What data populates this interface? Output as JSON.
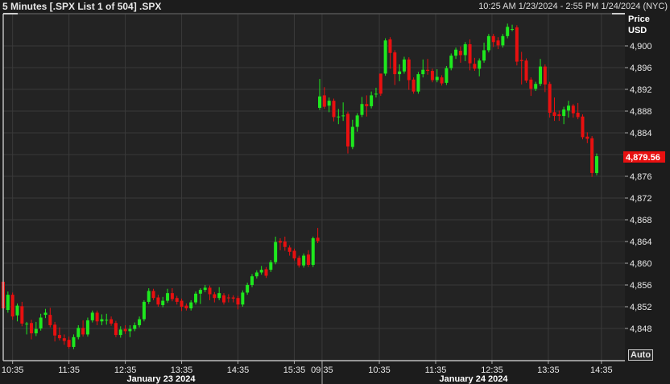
{
  "header": {
    "title": "5 Minutes [.SPX List 1 of 504] .SPX",
    "range": "10:25 AM 1/23/2024 - 2:55 PM 1/24/2024 (NYC)"
  },
  "axis_header": {
    "line1": "Price",
    "line2": "USD"
  },
  "auto_button": "Auto",
  "colors": {
    "up": "#1ee81e",
    "down": "#e81010",
    "bg": "#1c1c1c",
    "plot": "#232323",
    "grid": "#3a3a3a"
  },
  "chart_data": {
    "type": "candlestick",
    "title": "5 Minutes [.SPX List 1 of 504] .SPX",
    "ylabel": "Price USD",
    "ylim": [
      4844,
      4904
    ],
    "yticks": [
      "4,848",
      "4,852",
      "4,856",
      "4,860",
      "4,864",
      "4,868",
      "4,872",
      "4,876",
      "4,880",
      "4,884",
      "4,888",
      "4,892",
      "4,896",
      "4,900"
    ],
    "ytick_values": [
      4848,
      4852,
      4856,
      4860,
      4864,
      4868,
      4872,
      4876,
      4880,
      4884,
      4888,
      4892,
      4896,
      4900
    ],
    "last_price": {
      "value": 4879.56,
      "label": "4,879.56"
    },
    "xticks": [
      {
        "label": "10:35",
        "day": 0,
        "index": 2
      },
      {
        "label": "11:35",
        "day": 0,
        "index": 14
      },
      {
        "label": "12:35",
        "day": 0,
        "index": 26
      },
      {
        "label": "13:35",
        "day": 0,
        "index": 38
      },
      {
        "label": "14:35",
        "day": 0,
        "index": 50
      },
      {
        "label": "15:35",
        "day": 0,
        "index": 62
      },
      {
        "label": "09:35",
        "day": 1,
        "index": 0.5
      },
      {
        "label": "10:35",
        "day": 1,
        "index": 12.7
      },
      {
        "label": "11:35",
        "day": 1,
        "index": 24.7
      },
      {
        "label": "12:35",
        "day": 1,
        "index": 36.7
      },
      {
        "label": "13:35",
        "day": 1,
        "index": 48.7
      },
      {
        "label": "14:35",
        "day": 1,
        "index": 60
      }
    ],
    "days": [
      {
        "label": "January 23 2024",
        "candles": [
          [
            4856.6,
            4857.2,
            4850.9,
            4851.7
          ],
          [
            4851.4,
            4854.8,
            4850.9,
            4854.2
          ],
          [
            4854.2,
            4854.6,
            4849.6,
            4850.2
          ],
          [
            4850.4,
            4852.6,
            4849.3,
            4852.2
          ],
          [
            4852.1,
            4852.9,
            4848.4,
            4848.9
          ],
          [
            4848.9,
            4849.2,
            4846.9,
            4848.9
          ],
          [
            4849,
            4849.6,
            4846,
            4847.1
          ],
          [
            4847.1,
            4849.2,
            4846.6,
            4847.9
          ],
          [
            4848,
            4850.7,
            4847.6,
            4850
          ],
          [
            4850.5,
            4851.6,
            4849.9,
            4850.9
          ],
          [
            4850.5,
            4851.8,
            4848.2,
            4848.6
          ],
          [
            4848.7,
            4849.2,
            4845.6,
            4846.7
          ],
          [
            4846.8,
            4848.2,
            4845.8,
            4846.2
          ],
          [
            4846.2,
            4846.9,
            4845,
            4845.7
          ],
          [
            4845.9,
            4846.5,
            4844.3,
            4844.6
          ],
          [
            4844.6,
            4846.9,
            4844.2,
            4846.4
          ],
          [
            4846.4,
            4848.6,
            4846,
            4848.1
          ],
          [
            4848.1,
            4849.5,
            4846.5,
            4846.9
          ],
          [
            4846.9,
            4850,
            4846.5,
            4849.5
          ],
          [
            4849.5,
            4851.3,
            4849.1,
            4850.9
          ],
          [
            4850.9,
            4851.3,
            4848.6,
            4849.3
          ],
          [
            4849.3,
            4850.6,
            4848.6,
            4849.7
          ],
          [
            4849.6,
            4850.7,
            4848.7,
            4849.6
          ],
          [
            4849.7,
            4850.2,
            4848.5,
            4848.9
          ],
          [
            4849,
            4849.4,
            4846.4,
            4846.8
          ],
          [
            4846.8,
            4848.4,
            4846.3,
            4847.8
          ],
          [
            4847.9,
            4848.6,
            4847,
            4847.5
          ],
          [
            4847.5,
            4848.6,
            4846.4,
            4847.9
          ],
          [
            4847.9,
            4849.1,
            4847.5,
            4848.6
          ],
          [
            4848.6,
            4850.2,
            4848.2,
            4849.7
          ],
          [
            4849.7,
            4853.2,
            4849.3,
            4852.9
          ],
          [
            4852.9,
            4855.4,
            4852.5,
            4854.9
          ],
          [
            4854.9,
            4855.3,
            4853.2,
            4853.6
          ],
          [
            4853.7,
            4854.2,
            4852,
            4852.4
          ],
          [
            4852.3,
            4853.8,
            4851.9,
            4853.1
          ],
          [
            4853.1,
            4855.3,
            4852.7,
            4854.5
          ],
          [
            4854.5,
            4855.4,
            4853,
            4853.4
          ],
          [
            4853.6,
            4854,
            4852.4,
            4852.9
          ],
          [
            4853.1,
            4853.5,
            4851.2,
            4852
          ],
          [
            4852.2,
            4852.6,
            4851.3,
            4851.7
          ],
          [
            4851.7,
            4853.2,
            4851.3,
            4852.8
          ],
          [
            4852.8,
            4854.8,
            4852.4,
            4854.4
          ],
          [
            4854.4,
            4855.4,
            4852.5,
            4855.1
          ],
          [
            4855.1,
            4856,
            4854.7,
            4855.5
          ],
          [
            4855.5,
            4855.9,
            4853.2,
            4854.3
          ],
          [
            4854.3,
            4854.7,
            4852.8,
            4853.6
          ],
          [
            4853.6,
            4855.6,
            4853.2,
            4854.5
          ],
          [
            4854.1,
            4854.5,
            4852.4,
            4852.8
          ],
          [
            4853.7,
            4854.3,
            4852.8,
            4853.6
          ],
          [
            4853.7,
            4854.1,
            4852.8,
            4853.5
          ],
          [
            4853.6,
            4854,
            4851.5,
            4852.4
          ],
          [
            4852.4,
            4855,
            4852,
            4854.6
          ],
          [
            4854.6,
            4856.4,
            4854.2,
            4856
          ],
          [
            4856,
            4858,
            4855.6,
            4857.6
          ],
          [
            4857.6,
            4858.7,
            4857.2,
            4858.3
          ],
          [
            4858.3,
            4859.5,
            4857.9,
            4858.8
          ],
          [
            4858.9,
            4859.3,
            4857.3,
            4857.7
          ],
          [
            4858.8,
            4860.6,
            4858.4,
            4860.2
          ],
          [
            4860.2,
            4864.9,
            4859.8,
            4863.9
          ],
          [
            4864.1,
            4864.6,
            4862.4,
            4863.8
          ],
          [
            4864,
            4864.9,
            4862.3,
            4863
          ],
          [
            4862.9,
            4863.3,
            4861.4,
            4862.1
          ],
          [
            4862.3,
            4862.7,
            4860.5,
            4860.9
          ],
          [
            4861,
            4861.4,
            4859.2,
            4859.6
          ],
          [
            4859.6,
            4861.8,
            4859.2,
            4861.4
          ],
          [
            4861.6,
            4862.4,
            4859.3,
            4859.7
          ],
          [
            4859.7,
            4864.9,
            4859.3,
            4864.6
          ],
          [
            4864.7,
            4866.5,
            4863.7,
            4864.1
          ]
        ]
      },
      {
        "label": "January 24 2024",
        "candles": [
          [
            4888.6,
            4893.9,
            4888.2,
            4890.7
          ],
          [
            4890.9,
            4892.4,
            4888.4,
            4888.8
          ],
          [
            4889,
            4890.5,
            4887.8,
            4889.9
          ],
          [
            4889.9,
            4890.3,
            4886.1,
            4886.9
          ],
          [
            4887,
            4888.4,
            4885.6,
            4887
          ],
          [
            4887.2,
            4889.6,
            4886.2,
            4887.2
          ],
          [
            4887.5,
            4887.9,
            4880.2,
            4881.5
          ],
          [
            4881.4,
            4886.4,
            4881,
            4885.1
          ],
          [
            4885.1,
            4887.6,
            4884.2,
            4887.2
          ],
          [
            4887.3,
            4890.6,
            4886.9,
            4889.3
          ],
          [
            4889.3,
            4890.9,
            4887,
            4888.9
          ],
          [
            4888.9,
            4891.6,
            4888.5,
            4890.9
          ],
          [
            4891.2,
            4892.3,
            4890.5,
            4891.2
          ],
          [
            4894.9,
            4894.9,
            4890.8,
            4891.2
          ],
          [
            4894.9,
            4901.4,
            4894.5,
            4901
          ],
          [
            4901.2,
            4901.6,
            4895.8,
            4898.7
          ],
          [
            4898.8,
            4899.2,
            4892.8,
            4894.8
          ],
          [
            4894.8,
            4896.6,
            4893.5,
            4895.3
          ],
          [
            4895.3,
            4898,
            4894.9,
            4897.5
          ],
          [
            4897.5,
            4897.9,
            4891.9,
            4893.7
          ],
          [
            4893.8,
            4894.2,
            4891.2,
            4891.6
          ],
          [
            4891.6,
            4895.2,
            4891.2,
            4894.8
          ],
          [
            4894.8,
            4897.5,
            4894.2,
            4895.6
          ],
          [
            4895.6,
            4897.6,
            4894.7,
            4895.4
          ],
          [
            4895.4,
            4895.8,
            4893.3,
            4893.7
          ],
          [
            4893.7,
            4895.7,
            4893.3,
            4894.3
          ],
          [
            4894.2,
            4894.6,
            4892.7,
            4893.1
          ],
          [
            4893.2,
            4896.3,
            4892.8,
            4895.9
          ],
          [
            4895.9,
            4898.6,
            4895.5,
            4898.2
          ],
          [
            4898.2,
            4899.7,
            4897.6,
            4899.3
          ],
          [
            4899.1,
            4899.9,
            4896.9,
            4898.3
          ],
          [
            4898.3,
            4900.7,
            4897.2,
            4900.3
          ],
          [
            4900.3,
            4901.2,
            4895.5,
            4896.8
          ],
          [
            4896.7,
            4897.8,
            4895.4,
            4895.8
          ],
          [
            4895.8,
            4897.7,
            4894.4,
            4897.3
          ],
          [
            4897.3,
            4900.6,
            4896.9,
            4899.2
          ],
          [
            4899.2,
            4902.2,
            4898.8,
            4901.8
          ],
          [
            4901.8,
            4902.2,
            4899.8,
            4900.7
          ],
          [
            4901,
            4901.6,
            4899.4,
            4900.1
          ],
          [
            4900.1,
            4902.2,
            4899.7,
            4901.8
          ],
          [
            4901.8,
            4904.1,
            4901.4,
            4903.5
          ],
          [
            4903.1,
            4903.9,
            4902.7,
            4903.1
          ],
          [
            4903.4,
            4903.8,
            4896.4,
            4897.1
          ],
          [
            4897.4,
            4898.9,
            4892.9,
            4897.2
          ],
          [
            4897.3,
            4897.7,
            4893.2,
            4893.6
          ],
          [
            4893.8,
            4894.2,
            4890.8,
            4892.1
          ],
          [
            4892.1,
            4893.4,
            4891.7,
            4893
          ],
          [
            4893,
            4897.6,
            4892.6,
            4896.2
          ],
          [
            4896.2,
            4896.6,
            4891.5,
            4892.9
          ],
          [
            4893,
            4893.4,
            4886.8,
            4887.7
          ],
          [
            4887.8,
            4890.5,
            4886.2,
            4887.1
          ],
          [
            4887.4,
            4888.1,
            4886.2,
            4887.1
          ],
          [
            4887.1,
            4888.8,
            4885.6,
            4888.3
          ],
          [
            4888.1,
            4889.9,
            4886.8,
            4889
          ],
          [
            4889,
            4889.3,
            4886.8,
            4887.6
          ],
          [
            4887.7,
            4889.5,
            4886.5,
            4886.9
          ],
          [
            4887,
            4887.4,
            4882.8,
            4883.2
          ],
          [
            4883.3,
            4884.1,
            4882.1,
            4882.9
          ],
          [
            4883,
            4883.4,
            4875.9,
            4876.6
          ],
          [
            4876.6,
            4880.2,
            4876.2,
            4879.7
          ]
        ]
      }
    ]
  }
}
